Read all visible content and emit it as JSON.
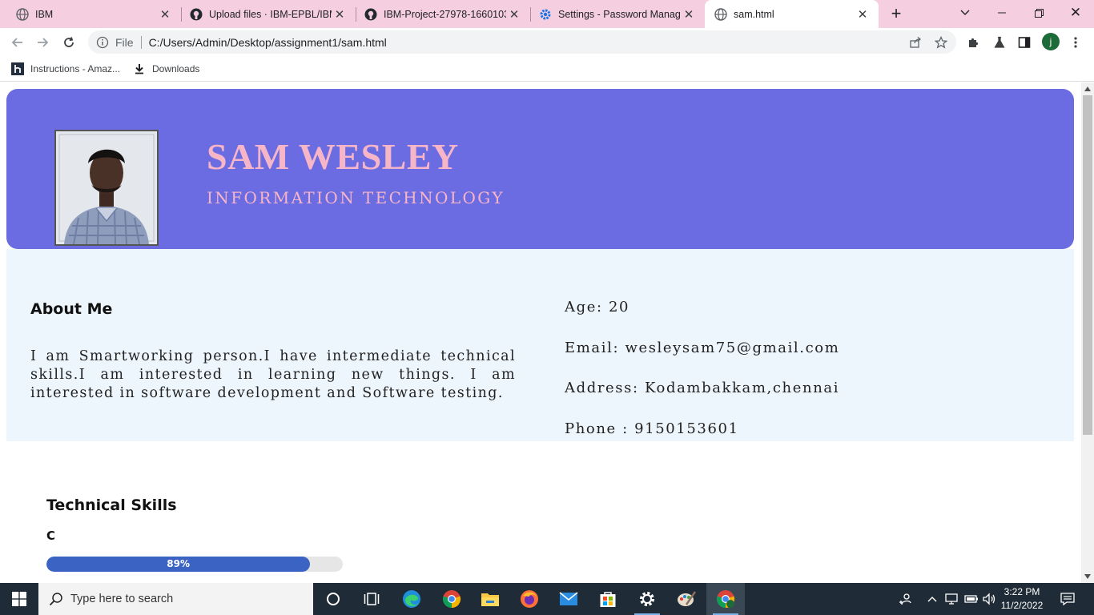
{
  "browser": {
    "tabs": [
      {
        "title": "IBM",
        "icon": "globe-icon"
      },
      {
        "title": "Upload files · IBM-EPBL/IBM-",
        "icon": "github-icon"
      },
      {
        "title": "IBM-Project-27978-1660103",
        "icon": "github-icon"
      },
      {
        "title": "Settings - Password Manager",
        "icon": "settings-gear-icon"
      },
      {
        "title": "sam.html",
        "icon": "globe-icon",
        "active": true
      }
    ],
    "address": {
      "scheme": "File",
      "url": "C:/Users/Admin/Desktop/assignment1/sam.html"
    },
    "profile_initial": "j",
    "bookmarks": [
      {
        "label": "Instructions - Amaz...",
        "icon": "h-bookmark-icon"
      },
      {
        "label": "Downloads",
        "icon": "download-icon"
      }
    ]
  },
  "page": {
    "name": "SAM WESLEY",
    "role": "INFORMATION TECHNOLOGY",
    "about_title": "About Me",
    "about_text": "I am Smartworking person.I have intermediate technical skills.I am interested in learning new things. I am interested in software development and Software testing.",
    "contact": {
      "age": "Age: 20",
      "email": "Email: wesleysam75@gmail.com",
      "address": "Address: Kodambakkam,chennai",
      "phone": "Phone : 9150153601"
    },
    "skills_title": "Technical Skills",
    "skills": [
      {
        "name": "C",
        "percent": 89,
        "percent_label": "89%"
      }
    ]
  },
  "taskbar": {
    "search_placeholder": "Type here to search",
    "time": "3:22 PM",
    "date": "11/2/2022"
  },
  "colors": {
    "tabstrip": "#f5cfe0",
    "hero_bg": "#6c6ce2",
    "hero_text": "#f7b5c8",
    "about_bg": "#eef6fd",
    "skill_fill": "#3a63c4",
    "taskbar": "#1f2b36"
  }
}
